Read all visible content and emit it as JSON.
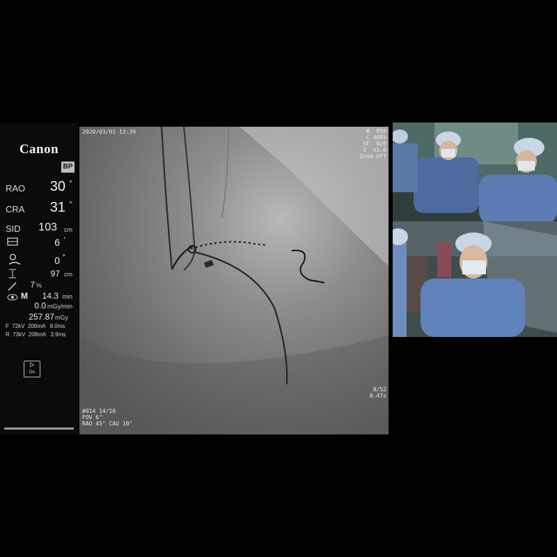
{
  "panel": {
    "brand": "Canon",
    "badge": "BP",
    "rao_label": "RAO",
    "rao_value": "30",
    "rao_unit": "°",
    "cra_label": "CRA",
    "cra_value": "31",
    "cra_unit": "°",
    "sid_label": "SID",
    "sid_value": "103",
    "sid_unit": "cm",
    "field_value": "6",
    "field_unit": "'",
    "table_rot_value": "0",
    "table_rot_unit": "°",
    "height_value": "97",
    "height_unit": "cm",
    "pct_value": "7",
    "pct_unit": "%",
    "mode_label": "M",
    "fluoro_time_value": "14.3",
    "fluoro_time_unit": "min",
    "dose_rate_value": "0.0",
    "dose_rate_unit": "mGy/min",
    "dose_total_value": "257.87",
    "dose_total_unit": "mGy",
    "f_line": "F  72kV  200mA   8.0ms",
    "r_line": "R  73kV  208mA   3.9ms",
    "da_label": "DA"
  },
  "angio": {
    "datetime": "2020/03/01 13:39",
    "tr_lines": [
      "B  850",
      "C 4095",
      "SF  020",
      "Z  x1.0",
      "Zoom Off"
    ],
    "frame": "8/52",
    "frame_time": "0.47s",
    "series": "#014 14/16",
    "fov": "FOV 6\"",
    "angle": "RAO 45° CAU 10°"
  },
  "icons": [
    "collimator-icon",
    "table-rotation-icon",
    "height-icon",
    "pen-icon",
    "eye-icon",
    "da-icon"
  ]
}
